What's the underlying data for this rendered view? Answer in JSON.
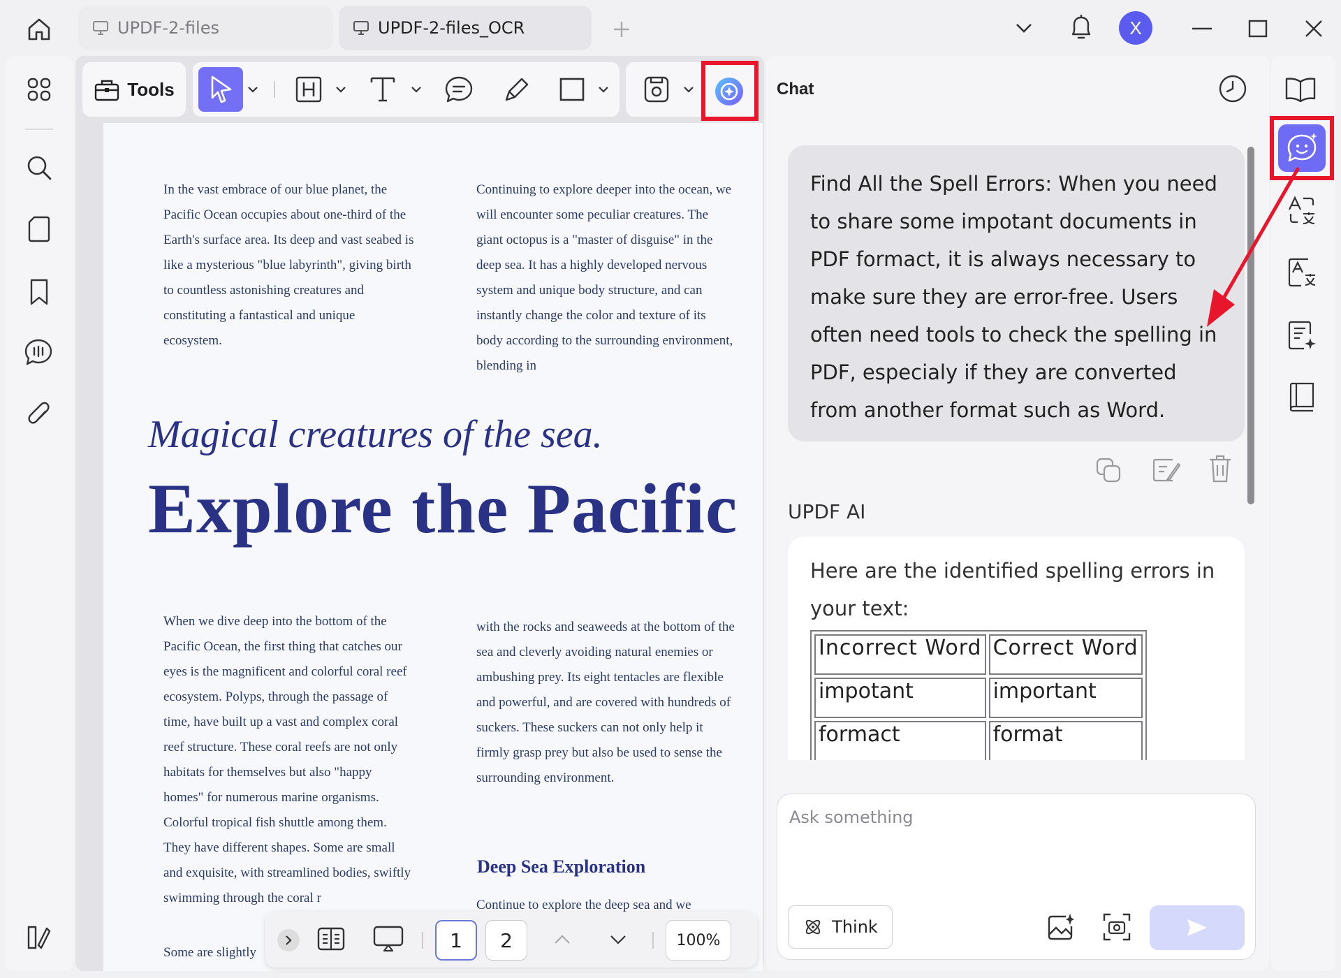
{
  "titlebar": {
    "tabs": [
      {
        "label": "UPDF-2-files",
        "icon": "monitor-icon"
      },
      {
        "label": "UPDF-2-files_OCR",
        "icon": "monitor-icon"
      }
    ],
    "add_tab_icon": "plus-icon",
    "avatar_letter": "X",
    "avatar_color": "#5b5bf0"
  },
  "toolbar": {
    "tools_label": "Tools",
    "accent": "#7470f5",
    "highlight_color": "#e8162b"
  },
  "document": {
    "col1": "In the vast embrace of our blue planet, the Pacific Ocean occupies about one-third of the Earth's surface area. Its deep and vast seabed is like a mysterious \"blue labyrinth\", giving birth to countless astonishing creatures and constituting a fantastical and unique ecosystem.",
    "col2": "Continuing to explore deeper into the ocean, we will encounter some peculiar creatures. The giant octopus is a \"master of disguise\" in the deep sea. It has a highly developed nervous system and unique body structure, and can instantly change the color and texture of its body according to the surrounding environment, blending in",
    "subtitle": "Magical creatures of the sea.",
    "title": "Explore the Pacific",
    "col3": "When we dive deep into the bottom of the Pacific Ocean, the first thing that catches our eyes is the magnificent and colorful coral reef ecosystem. Polyps, through the passage of time, have built up a vast and complex coral reef structure. These coral reefs are not only habitats for themselves but also \"happy homes\" for numerous marine organisms. Colorful tropical fish shuttle among them. They have different shapes. Some are small and exquisite, with streamlined bodies, swiftly swimming through the coral r",
    "col3_tail": "Some are slightly",
    "col4": "with the rocks and seaweeds at the bottom of the sea and cleverly avoiding natural enemies or ambushing prey. Its eight tentacles are flexible and powerful, and are covered with hundreds of suckers. These suckers can not only help it firmly grasp prey but also be used to sense the surrounding environment.",
    "section_heading": "Deep Sea Exploration",
    "col4b": "Continue to explore the deep sea and we"
  },
  "pagebar": {
    "pages": [
      "1",
      "2"
    ],
    "zoom": "100%"
  },
  "chat": {
    "title": "Chat",
    "user_message": "Find All the Spell Errors: When you need to share some impotant documents in PDF formact, it is always necessary to make sure they are error-free. Users often need tools to check the spelling in PDF, especialy if they are converted from another format such as Word.",
    "ai_label": "UPDF AI",
    "ai_intro": "Here are the identified spelling errors in your text:",
    "table": {
      "headers": [
        "Incorrect Word",
        "Correct Word"
      ],
      "rows": [
        [
          "impotant",
          "important"
        ],
        [
          "formact",
          "format"
        ]
      ]
    },
    "input_placeholder": "Ask something",
    "think_label": "Think"
  }
}
